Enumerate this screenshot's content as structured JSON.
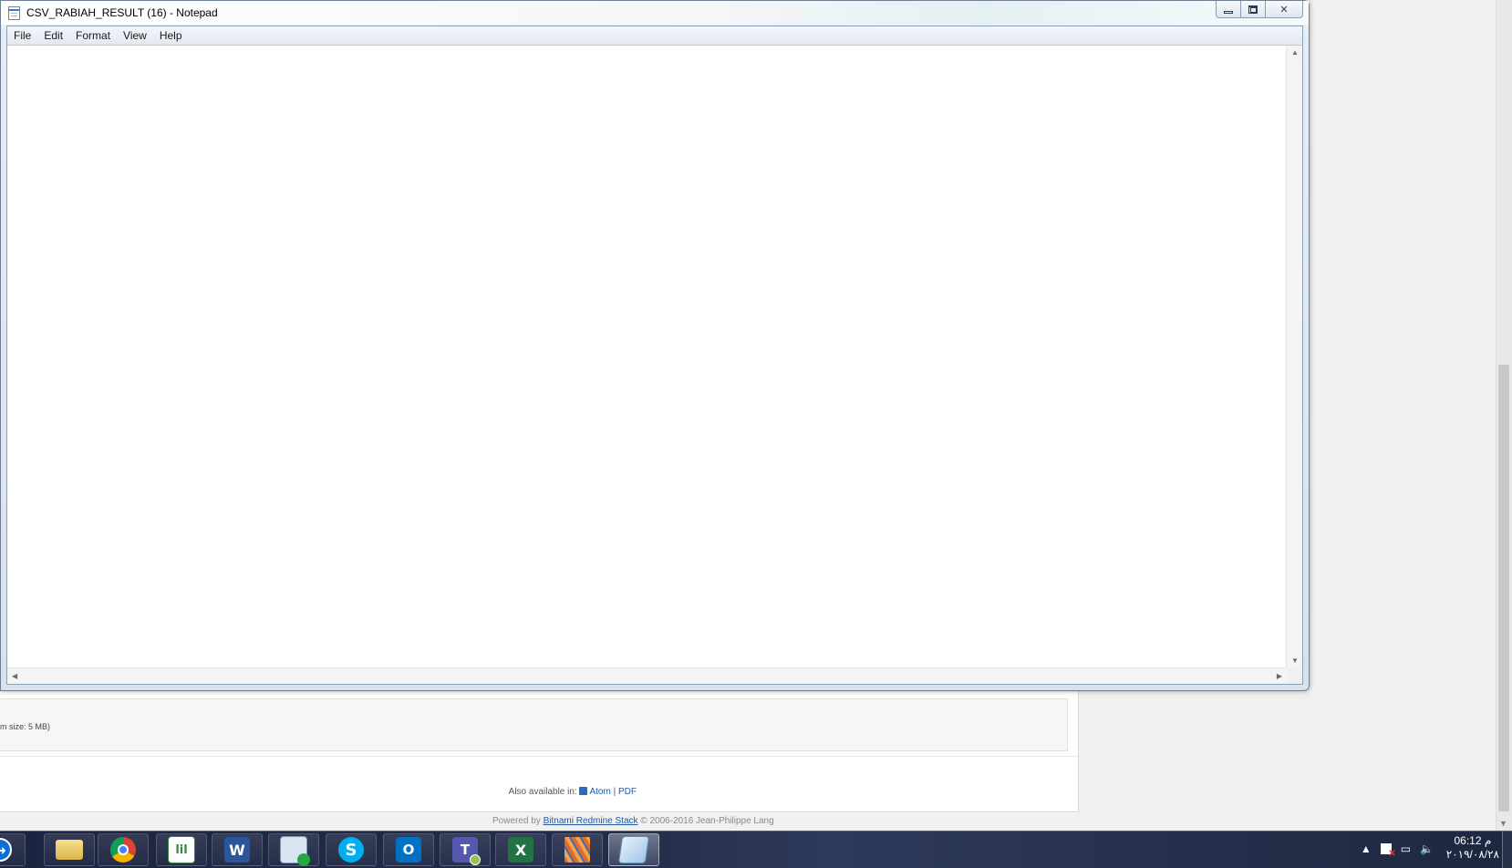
{
  "notepad": {
    "title": "CSV_RABIAH_RESULT (16) - Notepad",
    "menu": [
      "File",
      "Edit",
      "Format",
      "View",
      "Help"
    ],
    "content": ""
  },
  "background_page": {
    "size_note": "m size: 5 MB)",
    "also_available_label": "Also available in:",
    "atom_link": "Atom",
    "separator": "|",
    "pdf_link": "PDF",
    "footer_prefix": "Powered by",
    "footer_link": "Bitnami Redmine Stack",
    "footer_suffix": "© 2006-2016 Jean-Philippe Lang"
  },
  "taskbar": {
    "apps": [
      {
        "name": "teamviewer-icon",
        "glyph": "↔"
      },
      {
        "name": "windows-explorer-icon",
        "glyph": ""
      },
      {
        "name": "chrome-icon",
        "glyph": ""
      },
      {
        "name": "chart-app-icon",
        "glyph": "lil"
      },
      {
        "name": "word-icon",
        "glyph": "W"
      },
      {
        "name": "media-app-icon",
        "glyph": ""
      },
      {
        "name": "skype-icon",
        "glyph": "S"
      },
      {
        "name": "outlook-icon",
        "glyph": "O"
      },
      {
        "name": "teams-icon",
        "glyph": "T"
      },
      {
        "name": "excel-icon",
        "glyph": "X"
      },
      {
        "name": "striped-app-icon",
        "glyph": ""
      },
      {
        "name": "notepad-icon",
        "glyph": ""
      }
    ],
    "clock_time": "06:12 م",
    "clock_date": "٢٠١٩/٠٨/٢٨"
  },
  "colors": {
    "taskbar_bg": "#1c2440",
    "link_blue": "#1f5aa6",
    "window_frame": "#d6e2ef"
  }
}
